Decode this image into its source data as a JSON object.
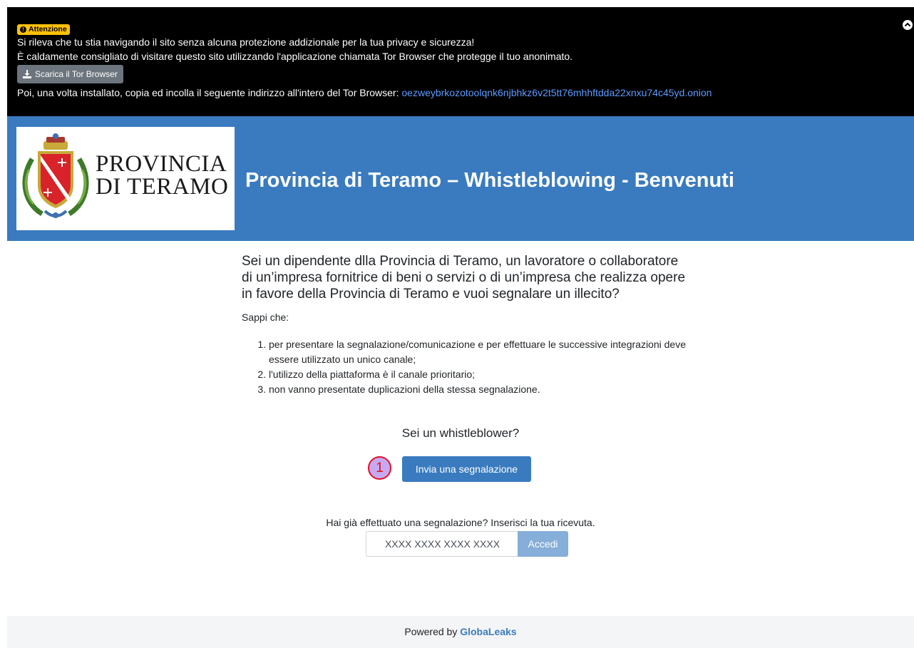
{
  "tor_banner": {
    "badge_label": "Attenzione",
    "line1": "Si rileva che tu stia navigando il sito senza alcuna protezione addizionale per la tua privacy e sicurezza!",
    "line2": "È caldamente consigliato di visitare questo sito utilizzando l'applicazione chiamata Tor Browser che protegge il tuo anonimato.",
    "download_button": "Scarica il Tor Browser",
    "line3": "Poi, una volta installato, copia ed incolla il seguente indirizzo all'intero del Tor Browser:",
    "onion_address": "oezweybrkozotoolqnk6njbhkz6v2t5tt76mhhftdda22xnxu74c45yd.onion"
  },
  "header": {
    "logo_line1": "PROVINCIA",
    "logo_line2": "DI TERAMO",
    "title": "Provincia di Teramo – Whistleblowing - Benvenuti"
  },
  "main": {
    "lead": "Sei un dipendente dlla Provincia di Teramo, un lavoratore o collaboratore di un’impresa fornitrice di beni o servizi o di un’impresa che realizza opere in favore della Provincia di Teramo e vuoi segnalare un illecito?",
    "intro": "Sappi che:",
    "rules": [
      "per presentare la segnalazione/comunicazione e per effettuare le successive integrazioni deve essere utilizzato un unico canale;",
      "l'utilizzo della piattaforma è il canale prioritario;",
      "non vanno presentate duplicazioni della stessa segnalazione."
    ],
    "whistleblower_question": "Sei un whistleblower?",
    "step_marker": "1",
    "submit_button": "Invia una segnalazione",
    "receipt_prompt": "Hai già effettuato una segnalazione? Inserisci la tua ricevuta.",
    "receipt_placeholder": "XXXX XXXX XXXX XXXX",
    "access_button": "Accedi"
  },
  "footer": {
    "powered_by": "Powered by",
    "brand": "GlobaLeaks"
  },
  "colors": {
    "header_blue": "#3a7bbf",
    "banner_black": "#000000",
    "badge_yellow": "#ffc107",
    "link_blue": "#5b9bff"
  }
}
